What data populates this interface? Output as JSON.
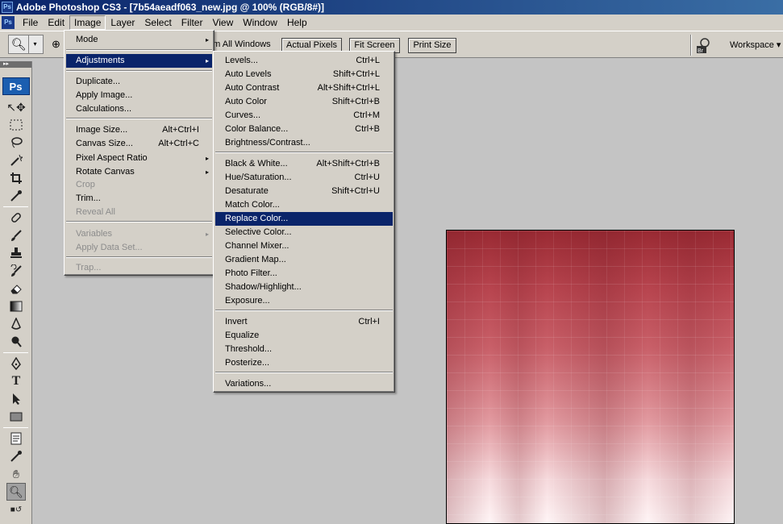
{
  "title": "Adobe Photoshop CS3 - [7b54aeadf063_new.jpg @ 100% (RGB/8#)]",
  "app_icon": "Ps",
  "menubar": [
    "File",
    "Edit",
    "Image",
    "Layer",
    "Select",
    "Filter",
    "View",
    "Window",
    "Help"
  ],
  "options": {
    "zoom_all": "om All Windows",
    "actual_pixels": "Actual Pixels",
    "fit_screen": "Fit Screen",
    "print_size": "Print Size",
    "workspace": "Workspace ▾"
  },
  "image_menu": [
    {
      "label": "Mode",
      "arrow": "▸"
    },
    {
      "label": "Adjustments",
      "arrow": "▸"
    },
    {
      "label": "Duplicate..."
    },
    {
      "label": "Apply Image..."
    },
    {
      "label": "Calculations..."
    },
    {
      "label": "Image Size...",
      "shortcut": "Alt+Ctrl+I"
    },
    {
      "label": "Canvas Size...",
      "shortcut": "Alt+Ctrl+C"
    },
    {
      "label": "Pixel Aspect Ratio",
      "arrow": "▸"
    },
    {
      "label": "Rotate Canvas",
      "arrow": "▸"
    },
    {
      "label": "Crop"
    },
    {
      "label": "Trim..."
    },
    {
      "label": "Reveal All"
    },
    {
      "label": "Variables",
      "arrow": "▸"
    },
    {
      "label": "Apply Data Set..."
    },
    {
      "label": "Trap..."
    }
  ],
  "adjustments_menu": [
    {
      "label": "Levels...",
      "shortcut": "Ctrl+L"
    },
    {
      "label": "Auto Levels",
      "shortcut": "Shift+Ctrl+L"
    },
    {
      "label": "Auto Contrast",
      "shortcut": "Alt+Shift+Ctrl+L"
    },
    {
      "label": "Auto Color",
      "shortcut": "Shift+Ctrl+B"
    },
    {
      "label": "Curves...",
      "shortcut": "Ctrl+M"
    },
    {
      "label": "Color Balance...",
      "shortcut": "Ctrl+B"
    },
    {
      "label": "Brightness/Contrast..."
    },
    {
      "label": "Black & White...",
      "shortcut": "Alt+Shift+Ctrl+B"
    },
    {
      "label": "Hue/Saturation...",
      "shortcut": "Ctrl+U"
    },
    {
      "label": "Desaturate",
      "shortcut": "Shift+Ctrl+U"
    },
    {
      "label": "Match Color..."
    },
    {
      "label": "Replace Color..."
    },
    {
      "label": "Selective Color..."
    },
    {
      "label": "Channel Mixer..."
    },
    {
      "label": "Gradient Map..."
    },
    {
      "label": "Photo Filter..."
    },
    {
      "label": "Shadow/Highlight..."
    },
    {
      "label": "Exposure..."
    },
    {
      "label": "Invert",
      "shortcut": "Ctrl+I"
    },
    {
      "label": "Equalize"
    },
    {
      "label": "Threshold..."
    },
    {
      "label": "Posterize..."
    },
    {
      "label": "Variations..."
    }
  ],
  "toolbox_logo": "Ps"
}
